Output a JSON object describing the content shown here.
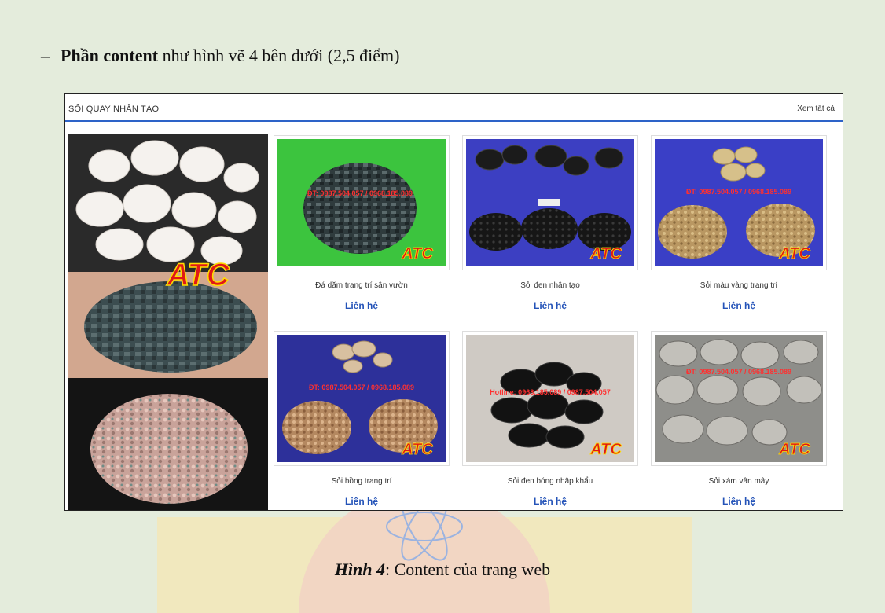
{
  "heading": {
    "dash": "–",
    "bold": "Phần content",
    "rest": " như hình vẽ 4 bên dưới (2,5 điểm)"
  },
  "panel": {
    "title": "SỎI QUAY NHÂN TẠO",
    "view_all": "Xem tất cả",
    "watermark_logo": "ATC",
    "products": [
      {
        "name": "Đá dăm trang trí sân vườn",
        "price": "Liên hệ",
        "logo": "ATC"
      },
      {
        "name": "Sỏi đen nhân tạo",
        "price": "Liên hệ",
        "logo": "ATC"
      },
      {
        "name": "Sỏi màu vàng trang trí",
        "price": "Liên hệ",
        "logo": "ATC"
      },
      {
        "name": "Sỏi hồng trang trí",
        "price": "Liên hệ",
        "logo": "ATC"
      },
      {
        "name": "Sỏi đen bóng nhập khẩu",
        "price": "Liên hệ",
        "logo": "ATC"
      },
      {
        "name": "Sỏi xám vân mây",
        "price": "Liên hệ",
        "logo": "ATC"
      }
    ]
  },
  "caption": {
    "label": "Hình 4",
    "text": ": Content của trang web"
  }
}
